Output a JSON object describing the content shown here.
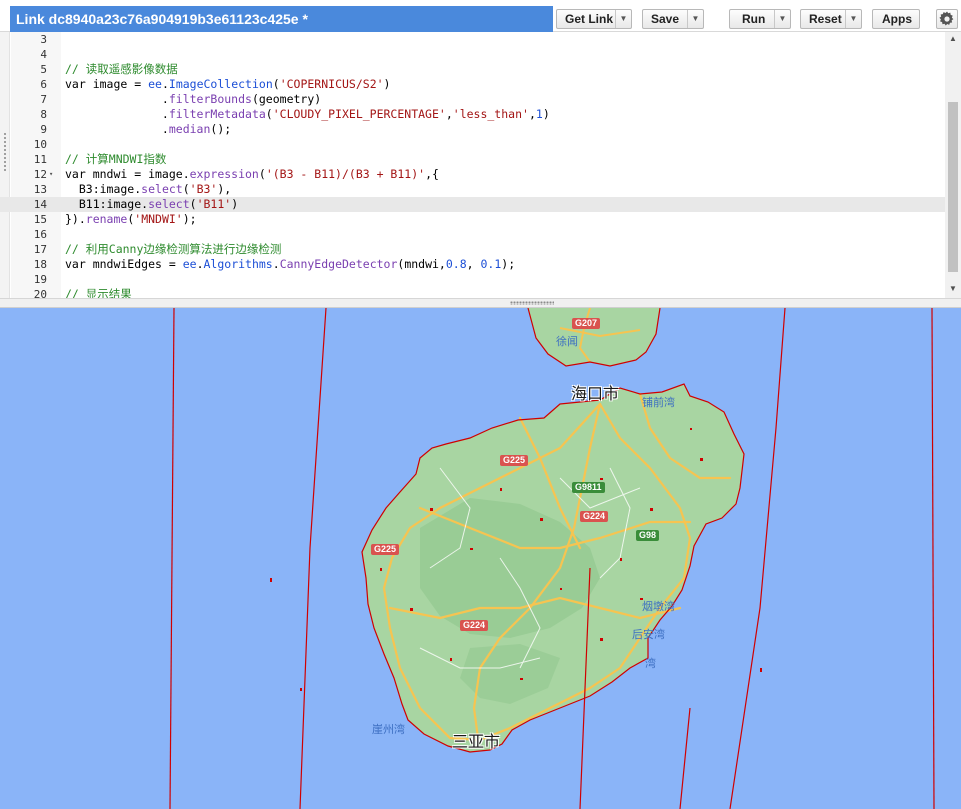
{
  "toolbar": {
    "script_title": "Link dc8940a23c76a904919b3e61123c425e *",
    "get_link_label": "Get Link",
    "save_label": "Save",
    "run_label": "Run",
    "reset_label": "Reset",
    "apps_label": "Apps",
    "dropdown_glyph": "▼",
    "settings_icon": "gear-icon"
  },
  "editor": {
    "lines": [
      {
        "n": "3",
        "text": ""
      },
      {
        "n": "4",
        "text": ""
      },
      {
        "n": "5",
        "text": "// 读取遥感影像数据"
      },
      {
        "n": "6",
        "text": "var image = ee.ImageCollection('COPERNICUS/S2')"
      },
      {
        "n": "7",
        "text": "              .filterBounds(geometry)"
      },
      {
        "n": "8",
        "text": "              .filterMetadata('CLOUDY_PIXEL_PERCENTAGE','less_than',1)"
      },
      {
        "n": "9",
        "text": "              .median();"
      },
      {
        "n": "10",
        "text": ""
      },
      {
        "n": "11",
        "text": "// 计算MNDWI指数"
      },
      {
        "n": "12",
        "text": "var mndwi = image.expression('(B3 - B11)/(B3 + B11)',{"
      },
      {
        "n": "13",
        "text": "  B3:image.select('B3'),"
      },
      {
        "n": "14",
        "text": "  B11:image.select('B11')"
      },
      {
        "n": "15",
        "text": "}).rename('MNDWI');"
      },
      {
        "n": "16",
        "text": ""
      },
      {
        "n": "17",
        "text": "// 利用Canny边缘检测算法进行边缘检测"
      },
      {
        "n": "18",
        "text": "var mndwiEdges = ee.Algorithms.CannyEdgeDetector(mndwi,0.8, 0.1);"
      },
      {
        "n": "19",
        "text": ""
      },
      {
        "n": "20",
        "text": "// 显示结果"
      }
    ],
    "active_line": "14",
    "fold_marker": "▾"
  },
  "map": {
    "cities": [
      {
        "id": "haikou",
        "label": "海口市"
      },
      {
        "id": "sanya",
        "label": "三亚市"
      }
    ],
    "towns": [
      {
        "id": "pu-qian",
        "label": "铺前湾"
      },
      {
        "id": "yan-tai",
        "label": "烟墩湾"
      },
      {
        "id": "hou-an",
        "label": "后安湾"
      },
      {
        "id": "east-bay",
        "label": "湾"
      },
      {
        "id": "xuwen",
        "label": "徐闻"
      },
      {
        "id": "yazhou",
        "label": "崖州湾"
      }
    ],
    "road_shields": [
      {
        "id": "g207",
        "label": "G207",
        "color": "red"
      },
      {
        "id": "g225-n",
        "label": "G225",
        "color": "red"
      },
      {
        "id": "g9811",
        "label": "G9811",
        "color": "green"
      },
      {
        "id": "g224-n",
        "label": "G224",
        "color": "red"
      },
      {
        "id": "g98",
        "label": "G98",
        "color": "green"
      },
      {
        "id": "g225-w",
        "label": "G225",
        "color": "red"
      },
      {
        "id": "g224-s",
        "label": "G224",
        "color": "red"
      }
    ],
    "colors": {
      "water": "#8ab4f8",
      "land": "#a8d5a2",
      "land_dark": "#8cc48a",
      "road": "#f6c451",
      "edge_overlay": "#d00000"
    }
  }
}
